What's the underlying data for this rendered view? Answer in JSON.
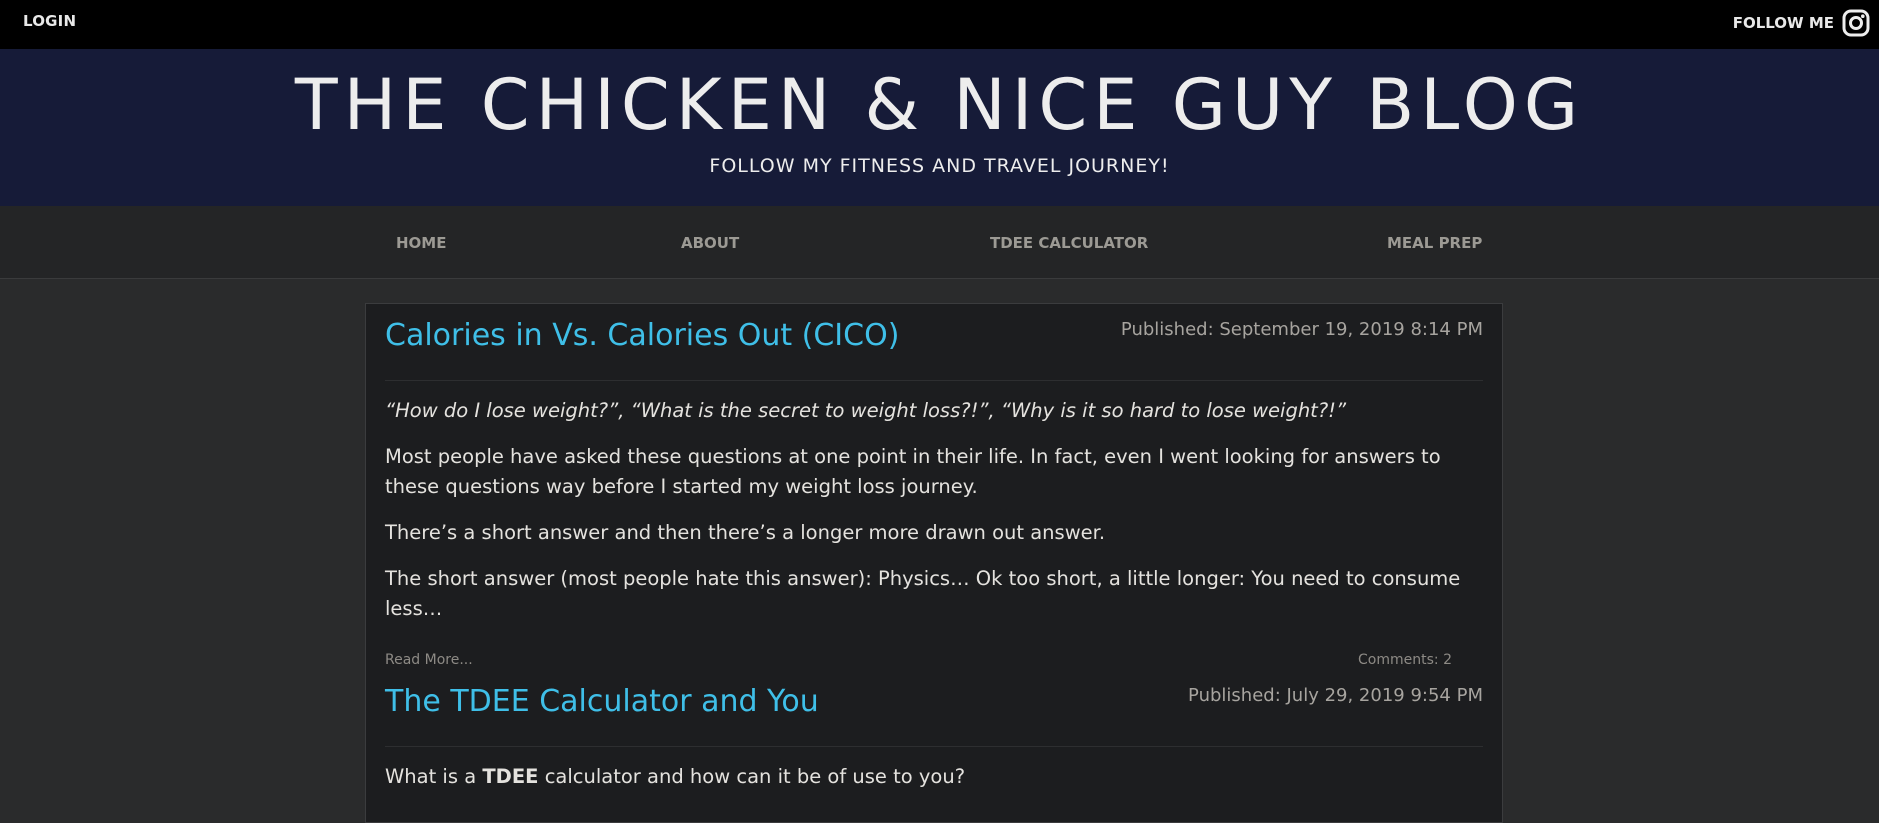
{
  "topbar": {
    "login": "LOGIN",
    "follow": "FOLLOW ME",
    "icon": "instagram-icon"
  },
  "header": {
    "title": "THE CHICKEN & NICE GUY BLOG",
    "tagline": "FOLLOW MY FITNESS AND TRAVEL JOURNEY!"
  },
  "nav": {
    "items": [
      "HOME",
      "ABOUT",
      "TDEE CALCULATOR",
      "MEAL PREP"
    ]
  },
  "posts": [
    {
      "title": "Calories in Vs. Calories Out (CICO)",
      "published": "Published: September 19, 2019 8:14 PM",
      "quote": "“How do I lose weight?”, “What is the secret to weight loss?!”, “Why is it so hard to lose weight?!”",
      "p1": "Most people have asked these questions at one point in their life. In fact, even I went looking for answers to these questions way before I started my weight loss journey.",
      "p2": "There’s a short answer and then there’s a longer more drawn out answer.",
      "p3": "The short answer (most people hate this answer): Physics… Ok too short, a little longer: You need to consume less…",
      "read_more": "Read More...",
      "comments": "Comments: 2"
    },
    {
      "title": "The TDEE Calculator and You",
      "published": "Published: July 29, 2019 9:54 PM",
      "p1_pre": "What is a ",
      "p1_bold": "TDEE",
      "p1_post": " calculator and how can it be of use to you?"
    }
  ],
  "colors": {
    "topbar": "#000000",
    "hero": "#161b38",
    "nav": "#242526",
    "body": "#2a2b2c",
    "card": "#1c1d1f",
    "link": "#3fbfe8"
  }
}
